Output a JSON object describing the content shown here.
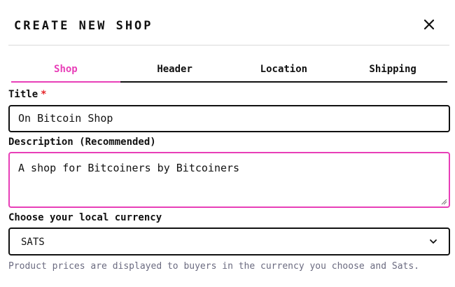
{
  "modal": {
    "title": "CREATE NEW SHOP",
    "close_icon": "close-icon"
  },
  "tabs": [
    {
      "label": "Shop",
      "active": true
    },
    {
      "label": "Header",
      "active": false
    },
    {
      "label": "Location",
      "active": false
    },
    {
      "label": "Shipping",
      "active": false
    }
  ],
  "form": {
    "title_label": "Title",
    "title_required_mark": "*",
    "title_value": "On Bitcoin Shop",
    "description_label": "Description (Recommended)",
    "description_value": "A shop for Bitcoiners by Bitcoiners",
    "currency_label": "Choose your local currency",
    "currency_value": "SATS",
    "currency_icon": "chevron-down-icon",
    "currency_helper": "Product prices are displayed to buyers in the currency you choose and Sats."
  },
  "colors": {
    "accent": "#e83fb8",
    "required": "#e5262b",
    "text": "#111111",
    "muted": "#6b6b80"
  }
}
